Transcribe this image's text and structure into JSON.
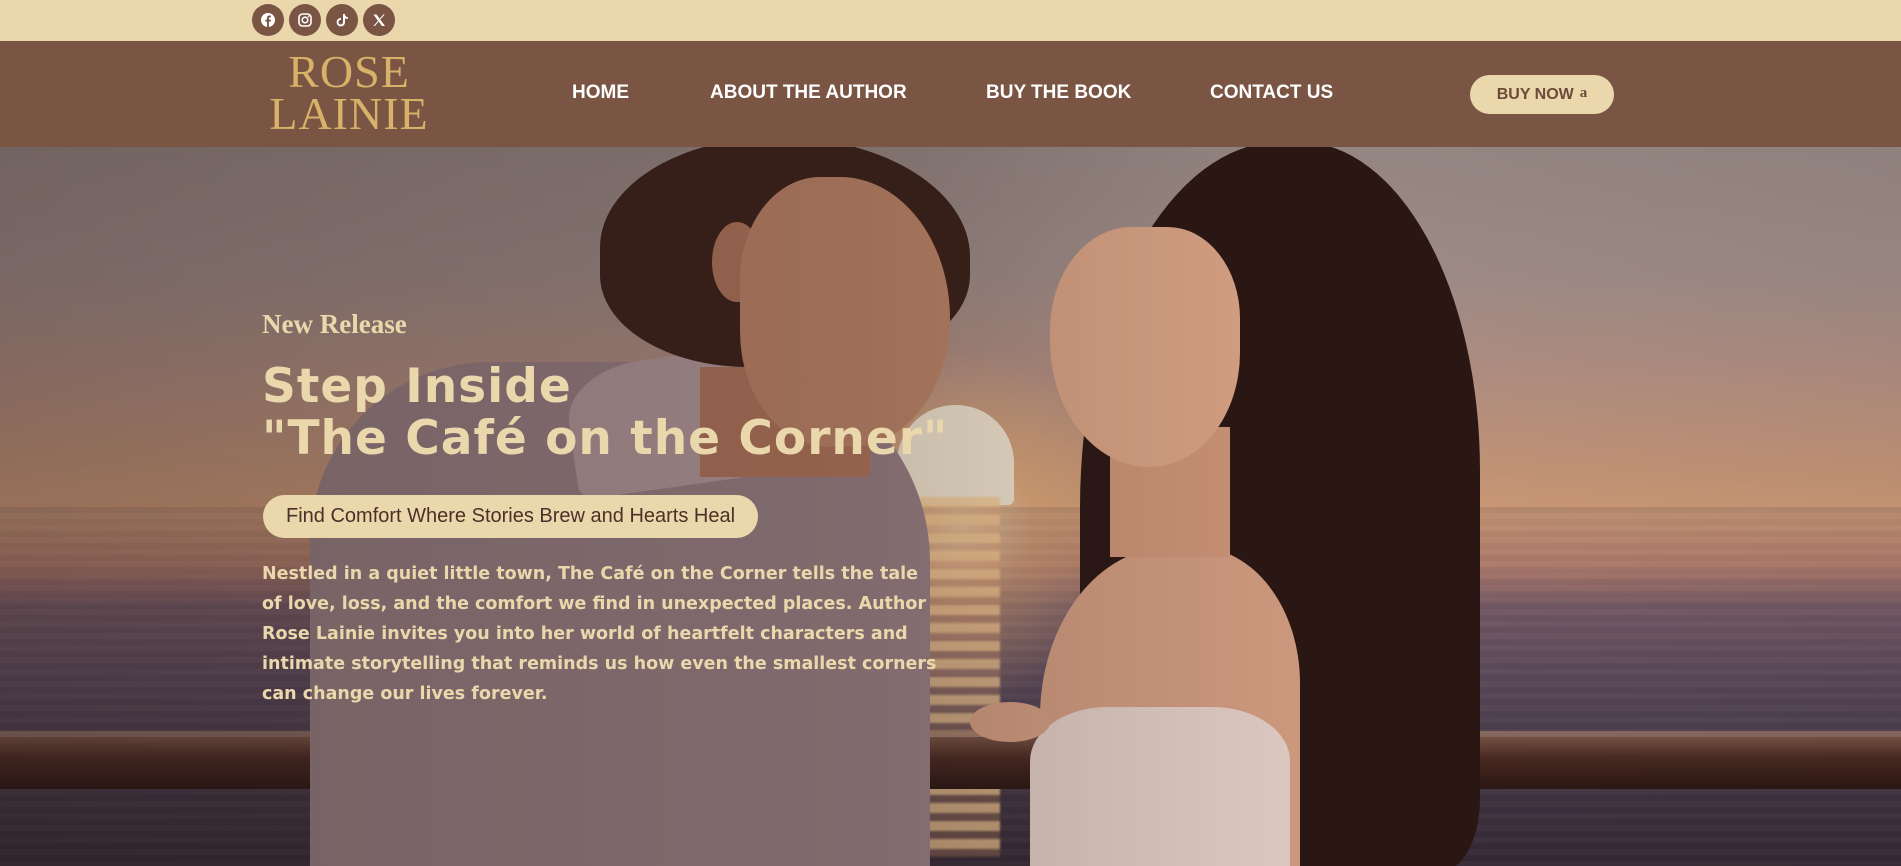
{
  "social": {
    "links": [
      {
        "name": "facebook-icon",
        "label": "f"
      },
      {
        "name": "instagram-icon",
        "label": ""
      },
      {
        "name": "tiktok-icon",
        "label": "♪"
      },
      {
        "name": "x-icon",
        "label": "X"
      }
    ]
  },
  "header": {
    "logo_line1": "ROSE",
    "logo_line2": "LAINIE",
    "nav": [
      {
        "label": "HOME"
      },
      {
        "label": "ABOUT THE AUTHOR"
      },
      {
        "label": "BUY THE BOOK"
      },
      {
        "label": "CONTACT US"
      }
    ],
    "buy_button": "BUY NOW",
    "buy_icon": "amazon-icon",
    "buy_glyph": "a"
  },
  "hero": {
    "eyebrow": "New Release",
    "headline_line1": "Step Inside",
    "headline_line2": "\"The Café on the Corner\"",
    "tagline": "Find Comfort Where Stories Brew and Hearts Heal",
    "body": "Nestled in a quiet little town, The Café on the Corner tells the tale of love, loss, and the comfort we find in unexpected places. Author Rose Lainie invites you into her world of heartfelt characters and intimate storytelling that reminds us how even the smallest corners can change our lives forever."
  },
  "colors": {
    "brand_brown": "#7b5544",
    "cream": "#ead8ac",
    "logo_gold": "#d9b26a"
  }
}
